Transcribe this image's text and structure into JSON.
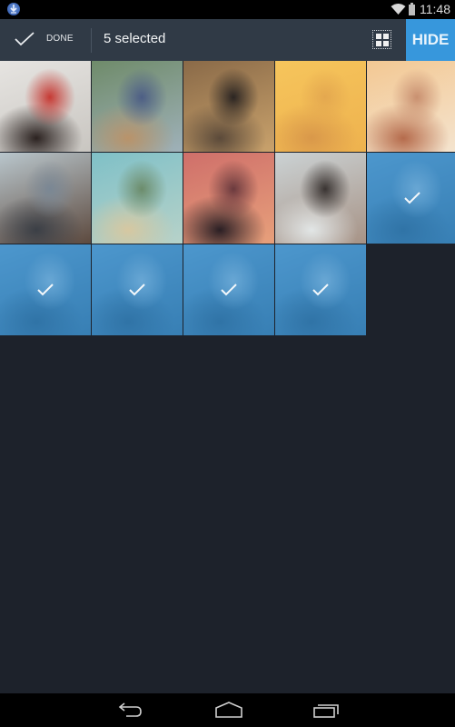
{
  "status_bar": {
    "notification_icon": "download-icon",
    "wifi_icon": "wifi-icon",
    "battery_icon": "battery-icon",
    "time": "11:48"
  },
  "action_bar": {
    "done_label": "DONE",
    "done_icon": "check-icon",
    "title": "5 selected",
    "grid_toggle_icon": "grid-view-icon",
    "hide_label": "HIDE",
    "accent_color": "#3797dc"
  },
  "grid": {
    "columns": 5,
    "items": [
      {
        "name": "photo-man-red-hoodie",
        "selected": false,
        "colors": [
          "#e6e4e1",
          "#c9c6c1",
          "#c63a34",
          "#2b2220"
        ]
      },
      {
        "name": "photo-man-with-cat",
        "selected": false,
        "colors": [
          "#6f8b6a",
          "#9fb1b9",
          "#4d5e85",
          "#b9936a"
        ]
      },
      {
        "name": "photo-restaurant-table",
        "selected": false,
        "colors": [
          "#8a6a48",
          "#c9a26c",
          "#2b2522",
          "#5b4a3a"
        ]
      },
      {
        "name": "photo-desert-mountain",
        "selected": false,
        "colors": [
          "#f6c55c",
          "#eeb24e",
          "#e4a84f",
          "#d9984a"
        ]
      },
      {
        "name": "photo-desert-ruins",
        "selected": false,
        "colors": [
          "#f3c893",
          "#f4e4cf",
          "#c99070",
          "#b56b4c"
        ]
      },
      {
        "name": "photo-man-closeup",
        "selected": false,
        "colors": [
          "#b9c6cc",
          "#5d4a3f",
          "#7a8794",
          "#3b3f46"
        ]
      },
      {
        "name": "photo-couple-sky",
        "selected": false,
        "colors": [
          "#7fc0c7",
          "#b7d2c9",
          "#6c8c6b",
          "#d6c8a1"
        ]
      },
      {
        "name": "photo-man-sunset",
        "selected": false,
        "colors": [
          "#cf6f6a",
          "#e7a07b",
          "#6b3a3e",
          "#2a1f24"
        ]
      },
      {
        "name": "photo-man-funny-face",
        "selected": false,
        "colors": [
          "#cbd2d4",
          "#a79386",
          "#3a3432",
          "#e2e6e6"
        ]
      },
      {
        "name": "photo-girl-blanket-1",
        "selected": true,
        "colors": [
          "#6aa4cc",
          "#3b6f95",
          "#a7c7dc",
          "#2b5677"
        ]
      },
      {
        "name": "photo-girl-blanket-2",
        "selected": true,
        "colors": [
          "#6aa4cc",
          "#3b6f95",
          "#a7c7dc",
          "#2b5677"
        ]
      },
      {
        "name": "photo-girl-blanket-3",
        "selected": true,
        "colors": [
          "#6aa4cc",
          "#3b6f95",
          "#a7c7dc",
          "#2b5677"
        ]
      },
      {
        "name": "photo-girl-blanket-4",
        "selected": true,
        "colors": [
          "#6aa4cc",
          "#3b6f95",
          "#a7c7dc",
          "#2b5677"
        ]
      },
      {
        "name": "photo-girl-blanket-5",
        "selected": true,
        "colors": [
          "#6aa4cc",
          "#3b6f95",
          "#a7c7dc",
          "#2b5677"
        ]
      }
    ]
  },
  "nav_bar": {
    "back_icon": "back-icon",
    "home_icon": "home-icon",
    "recents_icon": "recent-apps-icon"
  }
}
